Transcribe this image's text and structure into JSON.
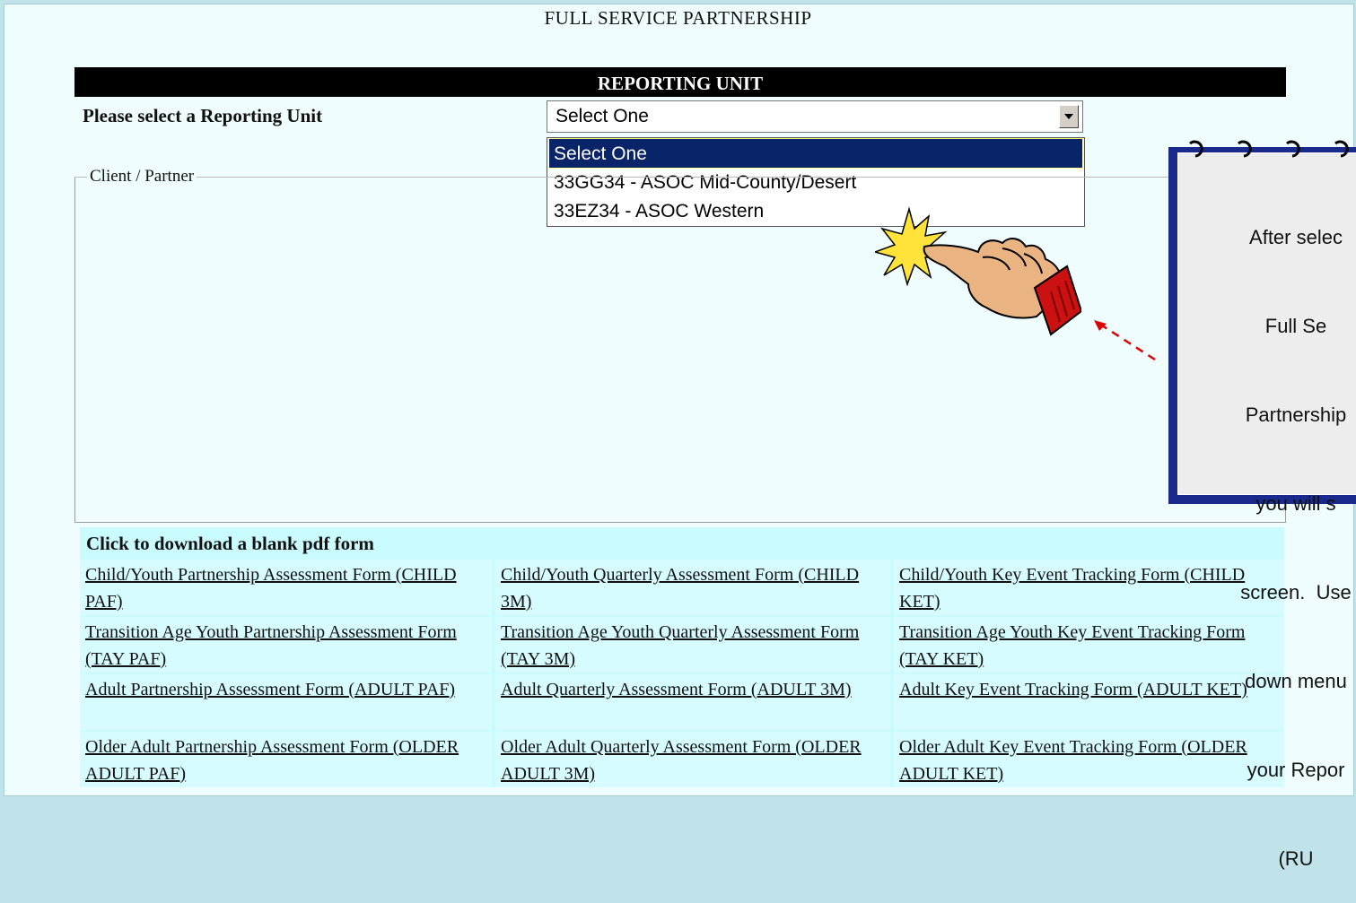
{
  "page": {
    "title": "FULL SERVICE PARTNERSHIP"
  },
  "reporting_unit": {
    "header": "REPORTING UNIT",
    "label": "Please select a Reporting Unit",
    "selected": "Select One",
    "options": [
      "Select One",
      "33GG34 - ASOC Mid-County/Desert",
      "33EZ34 - ASOC Western"
    ]
  },
  "client_partner": {
    "legend": "Client / Partner"
  },
  "forms": {
    "title": "Click to download a blank pdf form",
    "rows": [
      [
        "Child/Youth Partnership Assessment Form (CHILD PAF)",
        "Child/Youth Quarterly Assessment Form (CHILD 3M)",
        "Child/Youth Key Event Tracking Form (CHILD KET)"
      ],
      [
        "Transition Age Youth Partnership Assessment Form (TAY PAF)",
        "Transition Age Youth Quarterly Assessment Form (TAY 3M)",
        "Transition Age Youth Key Event Tracking Form (TAY KET)"
      ],
      [
        "Adult Partnership Assessment Form (ADULT PAF)",
        "Adult Quarterly Assessment Form (ADULT 3M)",
        "Adult Key Event Tracking Form (ADULT KET)"
      ],
      [
        "Older Adult Partnership Assessment Form (OLDER ADULT PAF)",
        "Older Adult Quarterly Assessment Form (OLDER ADULT 3M)",
        "Older Adult Key Event Tracking Form (OLDER ADULT KET)"
      ]
    ]
  },
  "callout": {
    "lines": [
      "After selec",
      "Full Se",
      "Partnership",
      "you will s",
      "screen.  Use",
      "down menu",
      "your Repor",
      "(RU"
    ]
  }
}
